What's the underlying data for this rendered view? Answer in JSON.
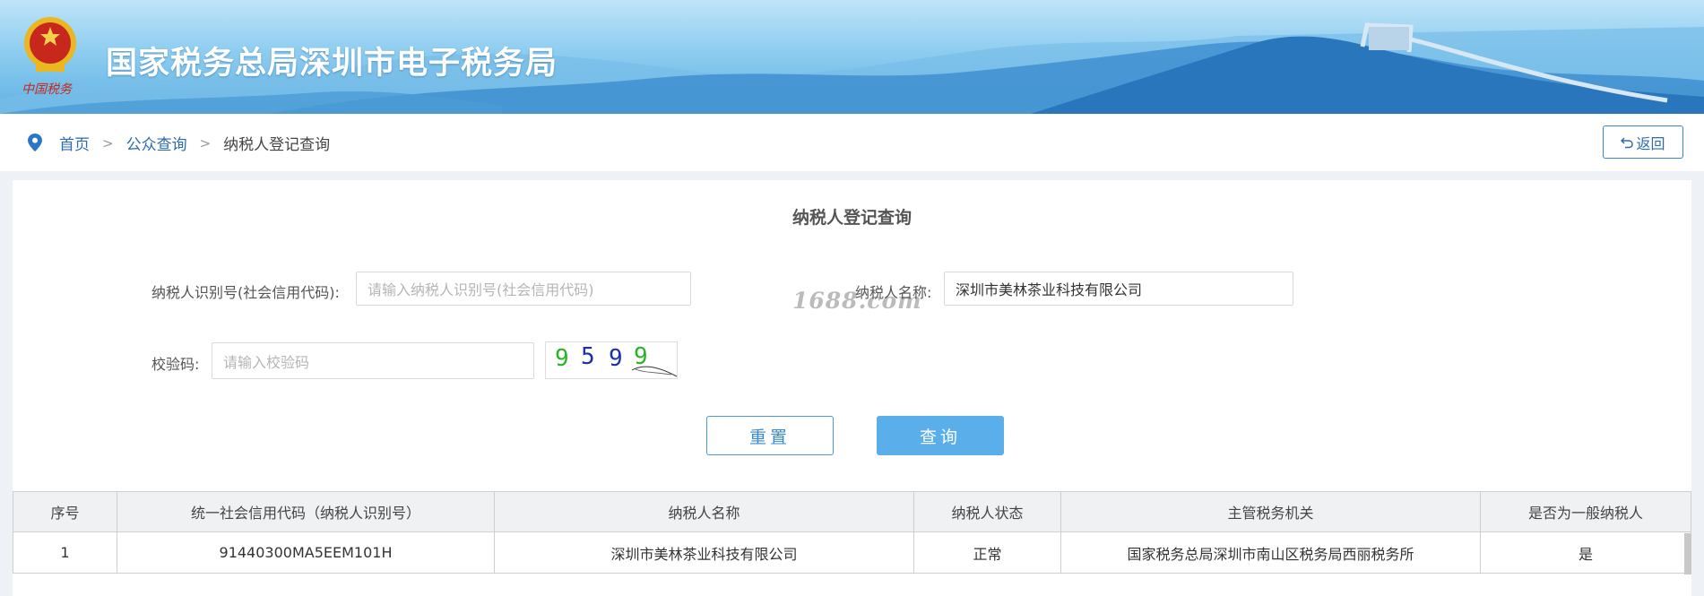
{
  "header": {
    "title": "国家税务总局深圳市电子税务局",
    "emblem_caption": "中国税务"
  },
  "breadcrumb": {
    "items": [
      "首页",
      "公众查询",
      "纳税人登记查询"
    ],
    "separator": ">",
    "back_label": "返回"
  },
  "form": {
    "title": "纳税人登记查询",
    "taxpayer_id": {
      "label": "纳税人识别号(社会信用代码):",
      "placeholder": "请输入纳税人识别号(社会信用代码)",
      "value": ""
    },
    "taxpayer_name": {
      "label": "纳税人名称:",
      "value": "深圳市美林茶业科技有限公司"
    },
    "verify_code": {
      "label": "校验码:",
      "placeholder": "请输入校验码",
      "value": ""
    },
    "captcha": {
      "digits": [
        "9",
        "5",
        "9",
        "9"
      ],
      "colors": [
        "#27b427",
        "#1c2fb0",
        "#1c2fb0",
        "#27b427"
      ]
    },
    "reset_label": "重置",
    "query_label": "查询"
  },
  "watermark": "1688.com",
  "results": {
    "columns": [
      "序号",
      "统一社会信用代码（纳税人识别号）",
      "纳税人名称",
      "纳税人状态",
      "主管税务机关",
      "是否为一般纳税人"
    ],
    "rows": [
      [
        "1",
        "91440300MA5EEM101H",
        "深圳市美林茶业科技有限公司",
        "正常",
        "国家税务总局深圳市南山区税务局西丽税务所",
        "是"
      ]
    ]
  },
  "colors": {
    "link": "#2a6cb0",
    "primary_button": "#5aaeea",
    "banner_sky": "#8ecdf0"
  }
}
